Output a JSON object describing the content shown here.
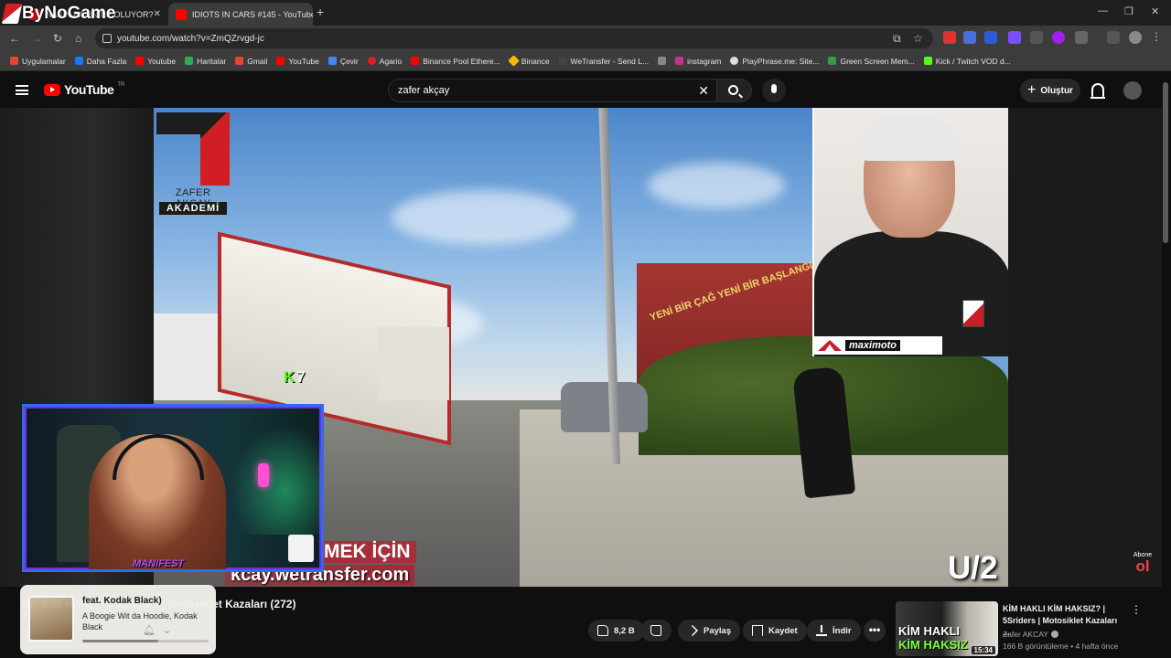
{
  "browser": {
    "overlay_logo": "ByNoGame",
    "tabs": [
      {
        "title": "NASIN BASIN NE OLUYOR?"
      },
      {
        "title": "IDIOTS IN CARS #145 - YouTube"
      }
    ],
    "new_tab": "+",
    "url": "youtube.com/watch?v=ZmQZrvgd-jc",
    "bookmarks": [
      {
        "label": "Uygulamalar",
        "color": "#e04b2b"
      },
      {
        "label": "Daha Fazla",
        "color": "#1877f2"
      },
      {
        "label": "Youtube",
        "color": "#ff0000"
      },
      {
        "label": "Haritalar",
        "color": "#34a853"
      },
      {
        "label": "Gmail",
        "color": "#ea4335"
      },
      {
        "label": "YouTube",
        "color": "#ff0000"
      },
      {
        "label": "Çevir",
        "color": "#4285f4"
      },
      {
        "label": "Agario",
        "color": "#e02020"
      },
      {
        "label": "Binance Pool Ethere...",
        "color": "#ff0000"
      },
      {
        "label": "Binance",
        "color": "#f0b90b"
      },
      {
        "label": "WeTransfer - Send L...",
        "color": "#444444"
      },
      {
        "label": "instagram",
        "color": "#c13584"
      },
      {
        "label": "PlayPhrase.me: Site...",
        "color": "#dddddd"
      },
      {
        "label": "Green Screen Mem...",
        "color": "#2f9e44"
      },
      {
        "label": "Kick / Twitch VOD d...",
        "color": "#53fc18"
      }
    ]
  },
  "youtube": {
    "logo_text": "YouTube",
    "logo_region": "TR",
    "search_value": "zafer akçay",
    "clear_glyph": "✕",
    "create_label": "Oluştur",
    "create_glyph": "+"
  },
  "player": {
    "brand_line1": "ZAFER AKÇAY",
    "brand_line2": "AKADEMİ",
    "kick_letter": "K",
    "kick_count": "7",
    "sign_text": "YENİ BİR ÇAĞ YENİ BİR BAŞLANGIÇ",
    "caption1": "MEK İÇİN",
    "caption2": "kcay.wetransfer.com",
    "position": "U/2",
    "badge_text": "maximoto",
    "abone_small": "Abone",
    "abone_big": "ol",
    "cam_tag": "MANIFEST"
  },
  "video": {
    "title": "B... KİM HAKLI? | 5Sriders | Motosiklet Kazaları (272)",
    "like_count": "8,2 B",
    "share_label": "Paylaş",
    "save_label": "Kaydet",
    "download_label": "İndir",
    "more_glyph": "•••"
  },
  "now_playing": {
    "title": "feat. Kodak Black)",
    "subtitle": "A Boogie Wit da Hoodie, Kodak Black",
    "progress": 0.6
  },
  "recommendation": {
    "thumb_line1": "KİM HAKLI",
    "thumb_line2": "KİM HAKSIZ",
    "duration": "15:34",
    "title": "KİM HAKLI KİM HAKSIZ? | 5Sriders | Motosiklet Kazaları ...",
    "channel": "Zafer AKCAY",
    "meta": "166 B görüntüleme • 4 hafta önce"
  }
}
